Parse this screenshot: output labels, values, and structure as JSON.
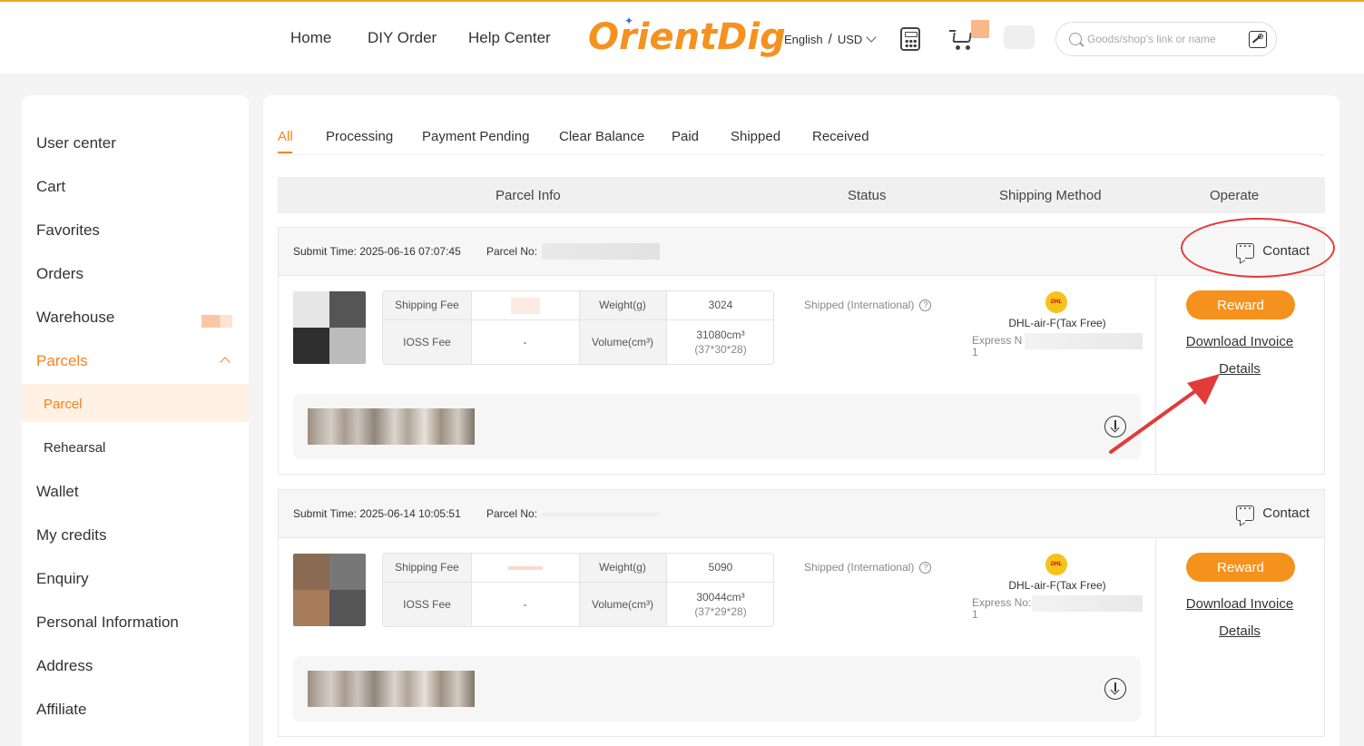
{
  "header": {
    "nav": [
      "Home",
      "DIY Order",
      "Help Center"
    ],
    "logo_text": "OrientDig",
    "language": "English",
    "currency": "USD",
    "search_placeholder": "Goods/shop's link or name"
  },
  "sidebar": {
    "items": [
      "User center",
      "Cart",
      "Favorites",
      "Orders",
      "Warehouse",
      "Parcels"
    ],
    "subitems": [
      "Parcel",
      "Rehearsal"
    ],
    "items_after": [
      "Wallet",
      "My credits",
      "Enquiry",
      "Personal Information",
      "Address",
      "Affiliate"
    ],
    "active_item": "Parcels",
    "active_subitem": "Parcel"
  },
  "tabs": [
    "All",
    "Processing",
    "Payment Pending",
    "Clear Balance",
    "Paid",
    "Shipped",
    "Received"
  ],
  "active_tab": "All",
  "columns": [
    "Parcel Info",
    "Status",
    "Shipping Method",
    "Operate"
  ],
  "parcels": [
    {
      "submit_time": "Submit Time: 2025-06-16 07:07:45",
      "parcel_no_label": "Parcel No:",
      "contact": "Contact",
      "shipping_fee_label": "Shipping Fee",
      "ioss_fee_label": "IOSS Fee",
      "ioss_fee": "-",
      "weight_label": "Weight(g)",
      "weight": "3024",
      "volume_label": "Volume(cm³)",
      "volume": "31080cm³",
      "dimensions": "(37*30*28)",
      "status": "Shipped (International)",
      "method": "DHL-air-F(Tax Free)",
      "express_label": "Express N",
      "express_line2": "1",
      "reward": "Reward",
      "download_invoice": "Download Invoice",
      "details": "Details"
    },
    {
      "submit_time": "Submit Time: 2025-06-14 10:05:51",
      "parcel_no_label": "Parcel No:",
      "contact": "Contact",
      "shipping_fee_label": "Shipping Fee",
      "ioss_fee_label": "IOSS Fee",
      "ioss_fee": "-",
      "weight_label": "Weight(g)",
      "weight": "5090",
      "volume_label": "Volume(cm³)",
      "volume": "30044cm³",
      "dimensions": "(37*29*28)",
      "status": "Shipped (International)",
      "method": "DHL-air-F(Tax Free)",
      "express_label": "Express No:",
      "express_line2": "1",
      "reward": "Reward",
      "download_invoice": "Download Invoice",
      "details": "Details"
    }
  ],
  "colors": {
    "accent": "#f5821f",
    "reward_button": "#f5921e",
    "annotation": "#e33a3a",
    "dhl_yellow": "#f7c31a"
  }
}
